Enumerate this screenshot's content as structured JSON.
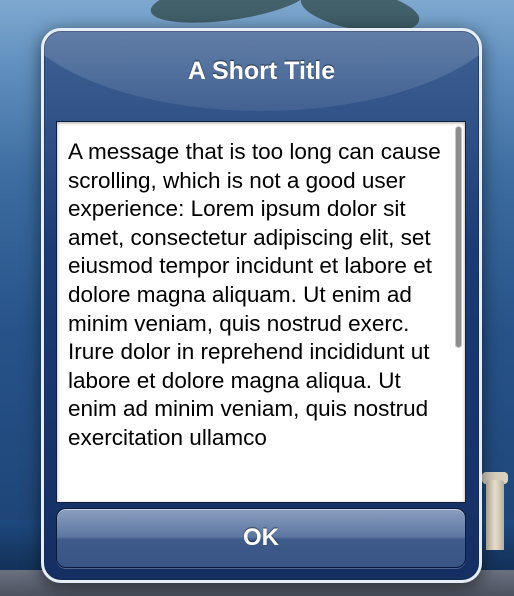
{
  "alert": {
    "title": "A Short Title",
    "message": "A message that is too long can cause scrolling, which is not a good user experience: Lorem ipsum dolor sit amet, consectetur adipiscing elit, set eiusmod tempor incidunt et labore et dolore magna aliquam. Ut enim ad minim veniam, quis nostrud exerc. Irure dolor in reprehend incididunt ut labore et dolore magna aliqua. Ut enim ad minim veniam, quis nostrud exercitation ullamco",
    "ok_label": "OK"
  },
  "colors": {
    "alert_background": "#1b3b74",
    "alert_border": "#e8eef7",
    "button": "#5d77a1",
    "message_background": "#ffffff"
  }
}
